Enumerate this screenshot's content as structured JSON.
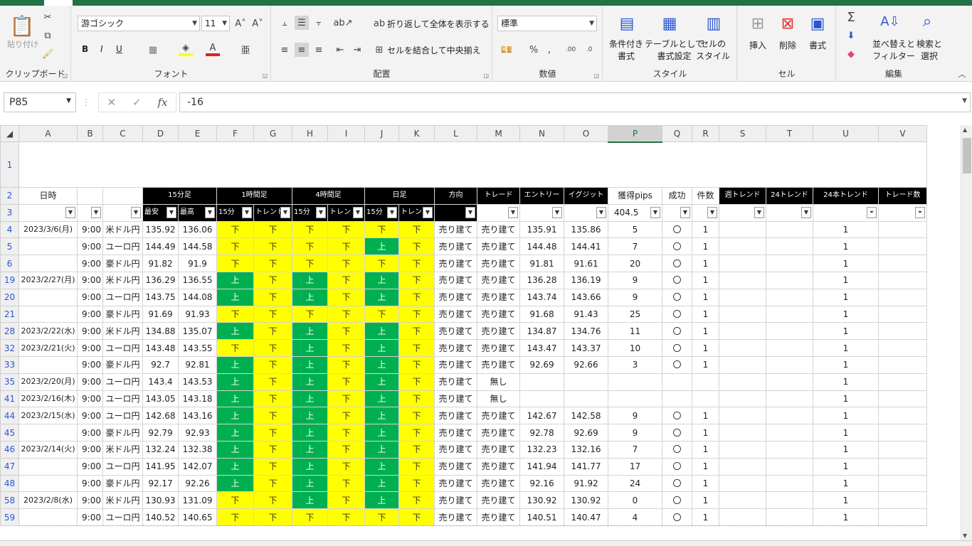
{
  "ribbon": {
    "clipboard": {
      "paste": "貼り付け",
      "label": "クリップボード"
    },
    "font": {
      "name": "游ゴシック",
      "size": "11",
      "label": "フォント",
      "bold": "B",
      "italic": "I",
      "underline": "U"
    },
    "alignment": {
      "wrap": "折り返して全体を表示する",
      "merge": "セルを結合して中央揃え",
      "label": "配置"
    },
    "number": {
      "format": "標準",
      "label": "数値"
    },
    "styles": {
      "conditional": "条件付き\n書式",
      "table": "テーブルとして\n書式設定",
      "cell": "セルの\nスタイル",
      "label": "スタイル"
    },
    "cells": {
      "insert": "挿入",
      "delete": "削除",
      "format": "書式",
      "label": "セル"
    },
    "editing": {
      "sort": "並べ替えと\nフィルター",
      "find": "検索と\n選択",
      "label": "編集"
    }
  },
  "formula": {
    "name_box": "P85",
    "value": "-16",
    "fx": "fx"
  },
  "columns": [
    "A",
    "B",
    "C",
    "D",
    "E",
    "F",
    "G",
    "H",
    "I",
    "J",
    "K",
    "L",
    "M",
    "N",
    "O",
    "P",
    "Q",
    "R",
    "S",
    "T",
    "U",
    "V"
  ],
  "header_row2": {
    "date": "日時",
    "b": "15分足",
    "c": "1時間足",
    "d": "4時間足",
    "e": "日足",
    "l": "方向",
    "m": "トレード",
    "n": "エントリー",
    "o": "イグジット",
    "p": "獲得pips",
    "q": "成功",
    "r": "件数",
    "s": "週トレンド",
    "t": "24トレンド",
    "u": "24本トレンド",
    "v": "トレード数"
  },
  "header_row3": {
    "d": "最安",
    "e": "最高",
    "f": "15分",
    "g": "トレンド",
    "h": "15分",
    "i": "トレンド",
    "j": "15分",
    "k": "トレンド",
    "p_total": "404.5"
  },
  "rows": [
    {
      "rn": "4",
      "date": "2023/3/6(月)",
      "time": "9:00",
      "pair": "米ドル円",
      "lo": "135.92",
      "hi": "136.06",
      "f": "下",
      "g": "下",
      "h": "下",
      "i": "下",
      "j": "下",
      "k": "下",
      "l": "売り建て",
      "m": "売り建て",
      "n": "135.91",
      "o": "135.86",
      "p": "5",
      "q": "〇",
      "r": "1",
      "u": "1"
    },
    {
      "rn": "5",
      "date": "",
      "time": "9:00",
      "pair": "ユーロ円",
      "lo": "144.49",
      "hi": "144.58",
      "f": "下",
      "g": "下",
      "h": "下",
      "i": "下",
      "j": "上",
      "k": "下",
      "l": "売り建て",
      "m": "売り建て",
      "n": "144.48",
      "o": "144.41",
      "p": "7",
      "q": "〇",
      "r": "1",
      "u": "1"
    },
    {
      "rn": "6",
      "date": "",
      "time": "9:00",
      "pair": "豪ドル円",
      "lo": "91.82",
      "hi": "91.9",
      "f": "下",
      "g": "下",
      "h": "下",
      "i": "下",
      "j": "下",
      "k": "下",
      "l": "売り建て",
      "m": "売り建て",
      "n": "91.81",
      "o": "91.61",
      "p": "20",
      "q": "〇",
      "r": "1",
      "u": "1"
    },
    {
      "rn": "19",
      "date": "2023/2/27(月)",
      "time": "9:00",
      "pair": "米ドル円",
      "lo": "136.29",
      "hi": "136.55",
      "f": "上",
      "g": "下",
      "h": "上",
      "i": "下",
      "j": "上",
      "k": "下",
      "l": "売り建て",
      "m": "売り建て",
      "n": "136.28",
      "o": "136.19",
      "p": "9",
      "q": "〇",
      "r": "1",
      "u": "1"
    },
    {
      "rn": "20",
      "date": "",
      "time": "9:00",
      "pair": "ユーロ円",
      "lo": "143.75",
      "hi": "144.08",
      "f": "上",
      "g": "下",
      "h": "上",
      "i": "下",
      "j": "上",
      "k": "下",
      "l": "売り建て",
      "m": "売り建て",
      "n": "143.74",
      "o": "143.66",
      "p": "9",
      "q": "〇",
      "r": "1",
      "u": "1"
    },
    {
      "rn": "21",
      "date": "",
      "time": "9:00",
      "pair": "豪ドル円",
      "lo": "91.69",
      "hi": "91.93",
      "f": "下",
      "g": "下",
      "h": "下",
      "i": "下",
      "j": "下",
      "k": "下",
      "l": "売り建て",
      "m": "売り建て",
      "n": "91.68",
      "o": "91.43",
      "p": "25",
      "q": "〇",
      "r": "1",
      "u": "1"
    },
    {
      "rn": "28",
      "date": "2023/2/22(水)",
      "time": "9:00",
      "pair": "米ドル円",
      "lo": "134.88",
      "hi": "135.07",
      "f": "上",
      "g": "下",
      "h": "上",
      "i": "下",
      "j": "上",
      "k": "下",
      "l": "売り建て",
      "m": "売り建て",
      "n": "134.87",
      "o": "134.76",
      "p": "11",
      "q": "〇",
      "r": "1",
      "u": "1"
    },
    {
      "rn": "32",
      "date": "2023/2/21(火)",
      "time": "9:00",
      "pair": "ユーロ円",
      "lo": "143.48",
      "hi": "143.55",
      "f": "下",
      "g": "下",
      "h": "上",
      "i": "下",
      "j": "上",
      "k": "下",
      "l": "売り建て",
      "m": "売り建て",
      "n": "143.47",
      "o": "143.37",
      "p": "10",
      "q": "〇",
      "r": "1",
      "u": "1"
    },
    {
      "rn": "33",
      "date": "",
      "time": "9:00",
      "pair": "豪ドル円",
      "lo": "92.7",
      "hi": "92.81",
      "f": "上",
      "g": "下",
      "h": "上",
      "i": "下",
      "j": "上",
      "k": "下",
      "l": "売り建て",
      "m": "売り建て",
      "n": "92.69",
      "o": "92.66",
      "p": "3",
      "q": "〇",
      "r": "1",
      "u": "1"
    },
    {
      "rn": "35",
      "date": "2023/2/20(月)",
      "time": "9:00",
      "pair": "ユーロ円",
      "lo": "143.4",
      "hi": "143.53",
      "f": "上",
      "g": "下",
      "h": "上",
      "i": "下",
      "j": "上",
      "k": "下",
      "l": "売り建て",
      "m": "無し",
      "n": "",
      "o": "",
      "p": "",
      "q": "",
      "r": "",
      "u": "1"
    },
    {
      "rn": "41",
      "date": "2023/2/16(木)",
      "time": "9:00",
      "pair": "ユーロ円",
      "lo": "143.05",
      "hi": "143.18",
      "f": "上",
      "g": "下",
      "h": "上",
      "i": "下",
      "j": "上",
      "k": "下",
      "l": "売り建て",
      "m": "無し",
      "n": "",
      "o": "",
      "p": "",
      "q": "",
      "r": "",
      "u": "1"
    },
    {
      "rn": "44",
      "date": "2023/2/15(水)",
      "time": "9:00",
      "pair": "ユーロ円",
      "lo": "142.68",
      "hi": "143.16",
      "f": "上",
      "g": "下",
      "h": "上",
      "i": "下",
      "j": "上",
      "k": "下",
      "l": "売り建て",
      "m": "売り建て",
      "n": "142.67",
      "o": "142.58",
      "p": "9",
      "q": "〇",
      "r": "1",
      "u": "1"
    },
    {
      "rn": "45",
      "date": "",
      "time": "9:00",
      "pair": "豪ドル円",
      "lo": "92.79",
      "hi": "92.93",
      "f": "上",
      "g": "下",
      "h": "上",
      "i": "下",
      "j": "上",
      "k": "下",
      "l": "売り建て",
      "m": "売り建て",
      "n": "92.78",
      "o": "92.69",
      "p": "9",
      "q": "〇",
      "r": "1",
      "u": "1"
    },
    {
      "rn": "46",
      "date": "2023/2/14(火)",
      "time": "9:00",
      "pair": "米ドル円",
      "lo": "132.24",
      "hi": "132.38",
      "f": "上",
      "g": "下",
      "h": "上",
      "i": "下",
      "j": "上",
      "k": "下",
      "l": "売り建て",
      "m": "売り建て",
      "n": "132.23",
      "o": "132.16",
      "p": "7",
      "q": "〇",
      "r": "1",
      "u": "1"
    },
    {
      "rn": "47",
      "date": "",
      "time": "9:00",
      "pair": "ユーロ円",
      "lo": "141.95",
      "hi": "142.07",
      "f": "上",
      "g": "下",
      "h": "上",
      "i": "下",
      "j": "上",
      "k": "下",
      "l": "売り建て",
      "m": "売り建て",
      "n": "141.94",
      "o": "141.77",
      "p": "17",
      "q": "〇",
      "r": "1",
      "u": "1"
    },
    {
      "rn": "48",
      "date": "",
      "time": "9:00",
      "pair": "豪ドル円",
      "lo": "92.17",
      "hi": "92.26",
      "f": "上",
      "g": "下",
      "h": "上",
      "i": "下",
      "j": "上",
      "k": "下",
      "l": "売り建て",
      "m": "売り建て",
      "n": "92.16",
      "o": "91.92",
      "p": "24",
      "q": "〇",
      "r": "1",
      "u": "1"
    },
    {
      "rn": "58",
      "date": "2023/2/8(水)",
      "time": "9:00",
      "pair": "米ドル円",
      "lo": "130.93",
      "hi": "131.09",
      "f": "下",
      "g": "下",
      "h": "上",
      "i": "下",
      "j": "上",
      "k": "下",
      "l": "売り建て",
      "m": "売り建て",
      "n": "130.92",
      "o": "130.92",
      "p": "0",
      "q": "〇",
      "r": "1",
      "u": "1"
    },
    {
      "rn": "59",
      "date": "",
      "time": "9:00",
      "pair": "ユーロ円",
      "lo": "140.52",
      "hi": "140.65",
      "f": "下",
      "g": "下",
      "h": "下",
      "i": "下",
      "j": "下",
      "k": "下",
      "l": "売り建て",
      "m": "売り建て",
      "n": "140.51",
      "o": "140.47",
      "p": "4",
      "q": "〇",
      "r": "1",
      "u": "1"
    }
  ]
}
